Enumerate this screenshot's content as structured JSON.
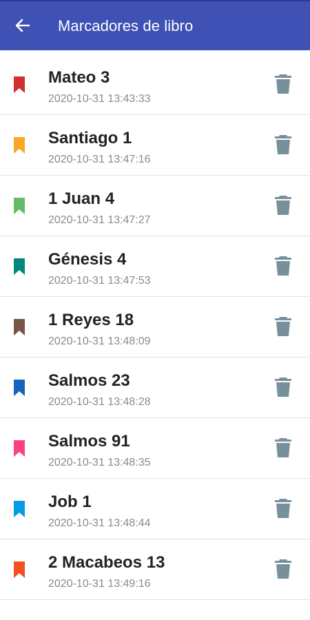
{
  "appbar": {
    "title": "Marcadores de libro",
    "back_icon": "arrow-back-icon",
    "color": "#3f51b5"
  },
  "bookmarks": [
    {
      "title": "Mateo 3",
      "timestamp": "2020-10-31 13:43:33",
      "color": "#d32f2f"
    },
    {
      "title": "Santiago 1",
      "timestamp": "2020-10-31 13:47:16",
      "color": "#f9a825"
    },
    {
      "title": "1 Juan 4",
      "timestamp": "2020-10-31 13:47:27",
      "color": "#66bb6a"
    },
    {
      "title": "Génesis 4",
      "timestamp": "2020-10-31 13:47:53",
      "color": "#00897b"
    },
    {
      "title": "1 Reyes 18",
      "timestamp": "2020-10-31 13:48:09",
      "color": "#795548"
    },
    {
      "title": "Salmos 23",
      "timestamp": "2020-10-31 13:48:28",
      "color": "#1565c0"
    },
    {
      "title": "Salmos 91",
      "timestamp": "2020-10-31 13:48:35",
      "color": "#ff4081"
    },
    {
      "title": "Job 1",
      "timestamp": "2020-10-31 13:48:44",
      "color": "#039be5"
    },
    {
      "title": "2 Macabeos 13",
      "timestamp": "2020-10-31 13:49:16",
      "color": "#f4511e"
    }
  ],
  "icons": {
    "bookmark": "bookmark-icon",
    "delete": "trash-icon"
  },
  "trash_color": "#78909c"
}
